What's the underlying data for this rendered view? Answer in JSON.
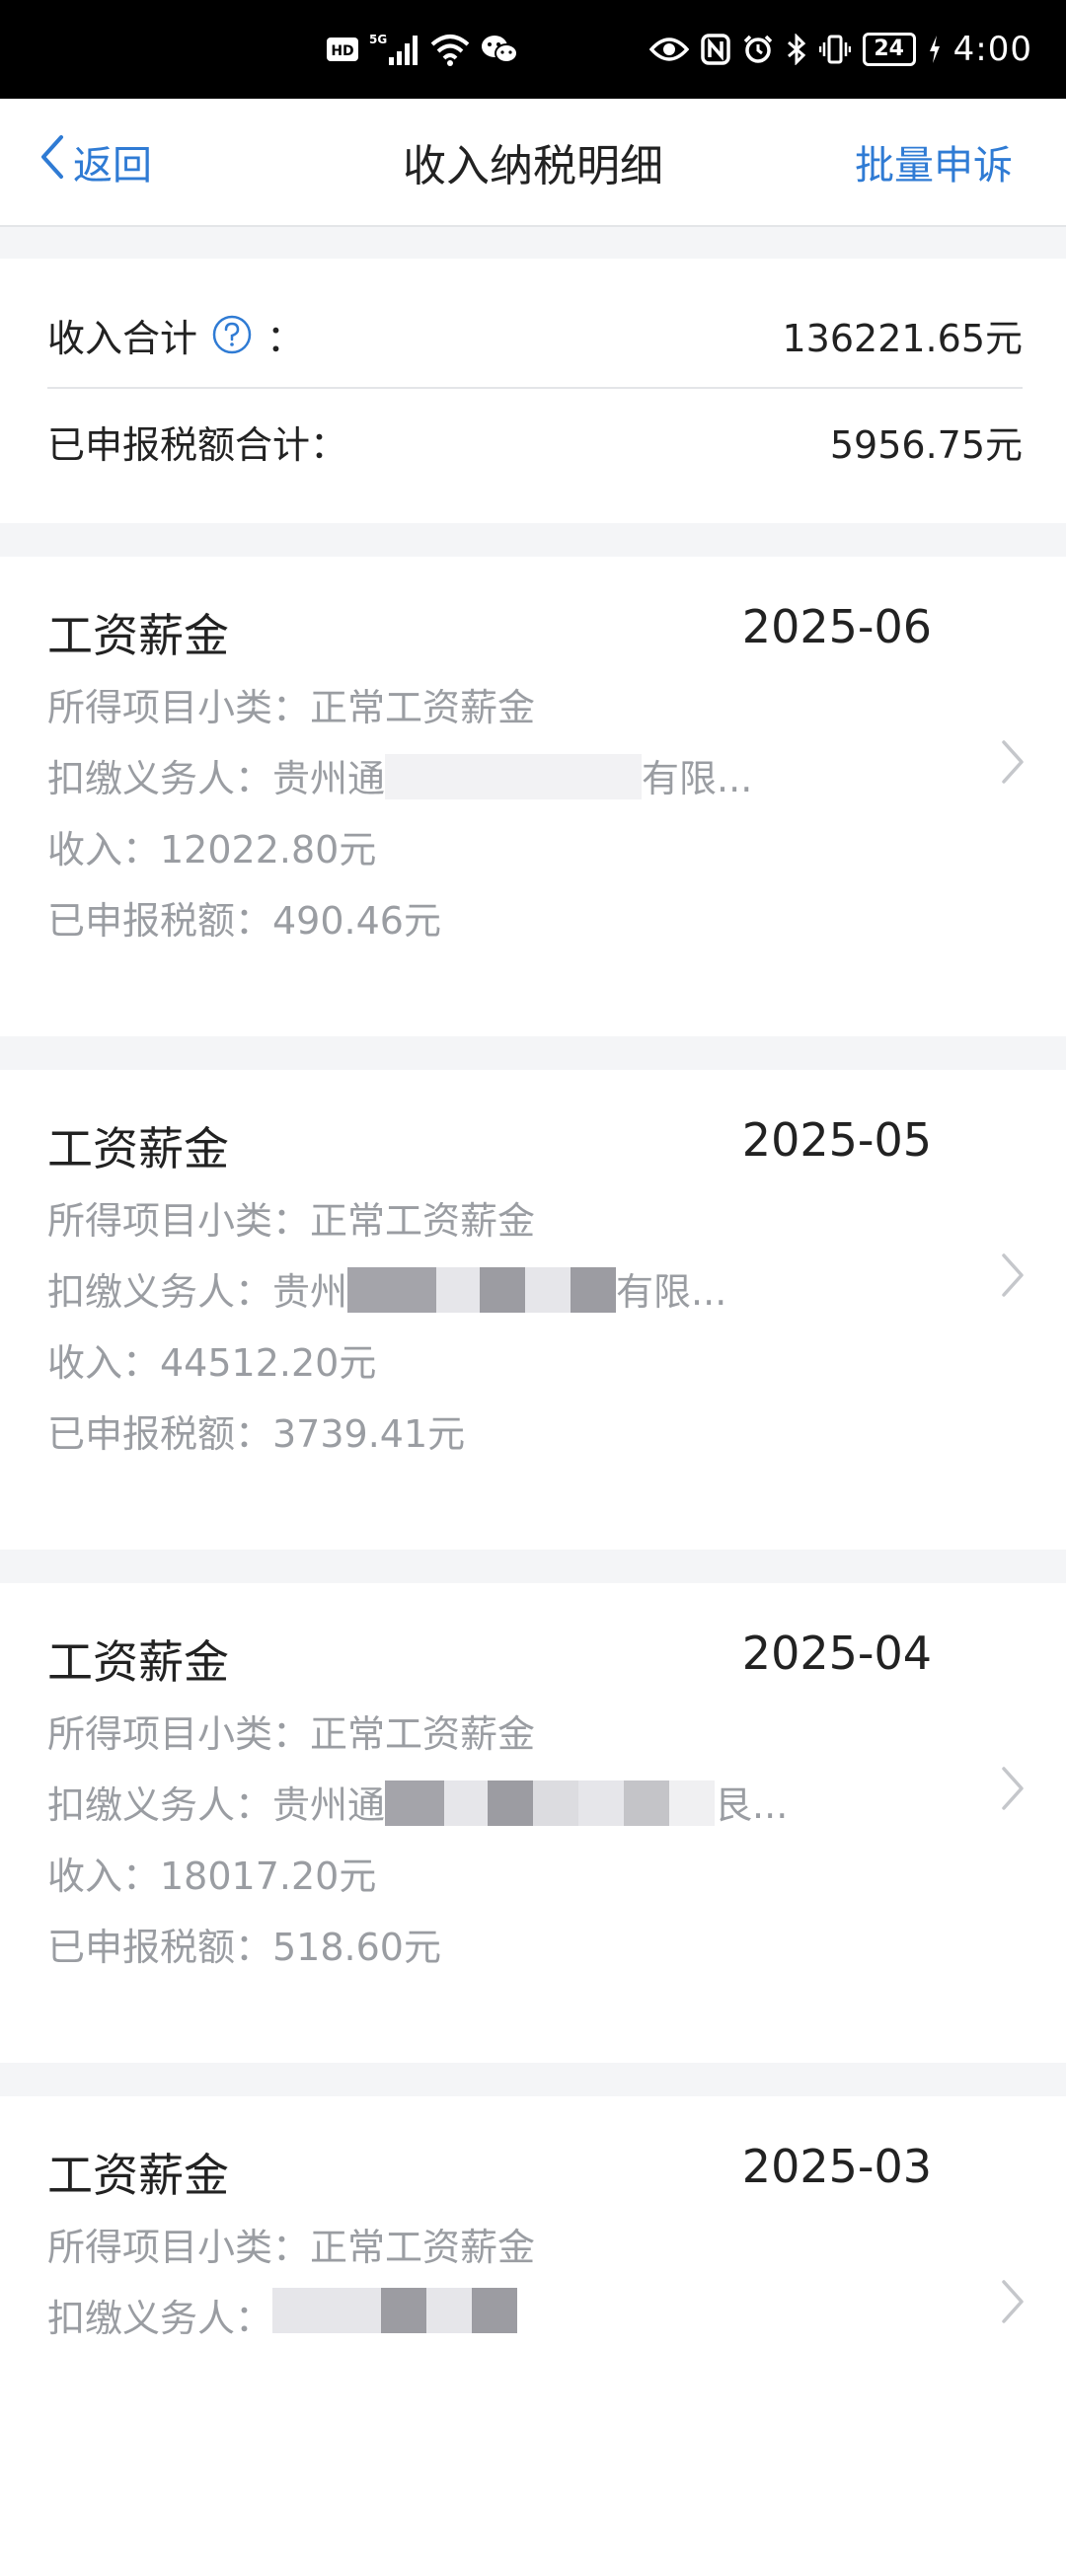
{
  "status_bar": {
    "hd_badge": "HD",
    "network": "5G",
    "battery": "24",
    "time": "4:00",
    "icons": [
      "hd-icon",
      "signal-5g-icon",
      "wifi-icon",
      "wechat-icon",
      "eye-icon",
      "nfc-icon",
      "alarm-icon",
      "bluetooth-icon",
      "vibrate-icon",
      "battery-icon",
      "charging-icon"
    ]
  },
  "header": {
    "back_label": "返回",
    "title": "收入纳税明细",
    "batch_label": "批量申诉"
  },
  "summary": {
    "income_label": "收入合计",
    "income_colon": "：",
    "income_value": "136221.65元",
    "tax_label": "已申报税额合计：",
    "tax_value": "5956.75元"
  },
  "records": [
    {
      "type": "工资薪金",
      "date": "2025-06",
      "subcategory": "所得项目小类：正常工资薪金",
      "payer_label": "扣缴义务人：",
      "payer_value": "贵州通",
      "payer_suffix": "有限...",
      "income": "收入：12022.80元",
      "tax": "已申报税额：490.46元"
    },
    {
      "type": "工资薪金",
      "date": "2025-05",
      "subcategory": "所得项目小类：正常工资薪金",
      "payer_label": "扣缴义务人：",
      "payer_value": "贵州",
      "payer_suffix": "有限...",
      "income": "收入：44512.20元",
      "tax": "已申报税额：3739.41元"
    },
    {
      "type": "工资薪金",
      "date": "2025-04",
      "subcategory": "所得项目小类：正常工资薪金",
      "payer_label": "扣缴义务人：",
      "payer_value": "贵州通",
      "payer_suffix": "艮...",
      "income": "收入：18017.20元",
      "tax": "已申报税额：518.60元"
    },
    {
      "type": "工资薪金",
      "date": "2025-03",
      "subcategory": "所得项目小类：正常工资薪金",
      "payer_label": "扣缴义务人：",
      "payer_value": "",
      "payer_suffix": "",
      "income": "",
      "tax": ""
    }
  ],
  "colors": {
    "accent": "#2f7bd4",
    "text_primary": "#222222",
    "text_secondary": "#9a9da2",
    "page_bg": "#f4f5f7",
    "card_bg": "#ffffff"
  }
}
